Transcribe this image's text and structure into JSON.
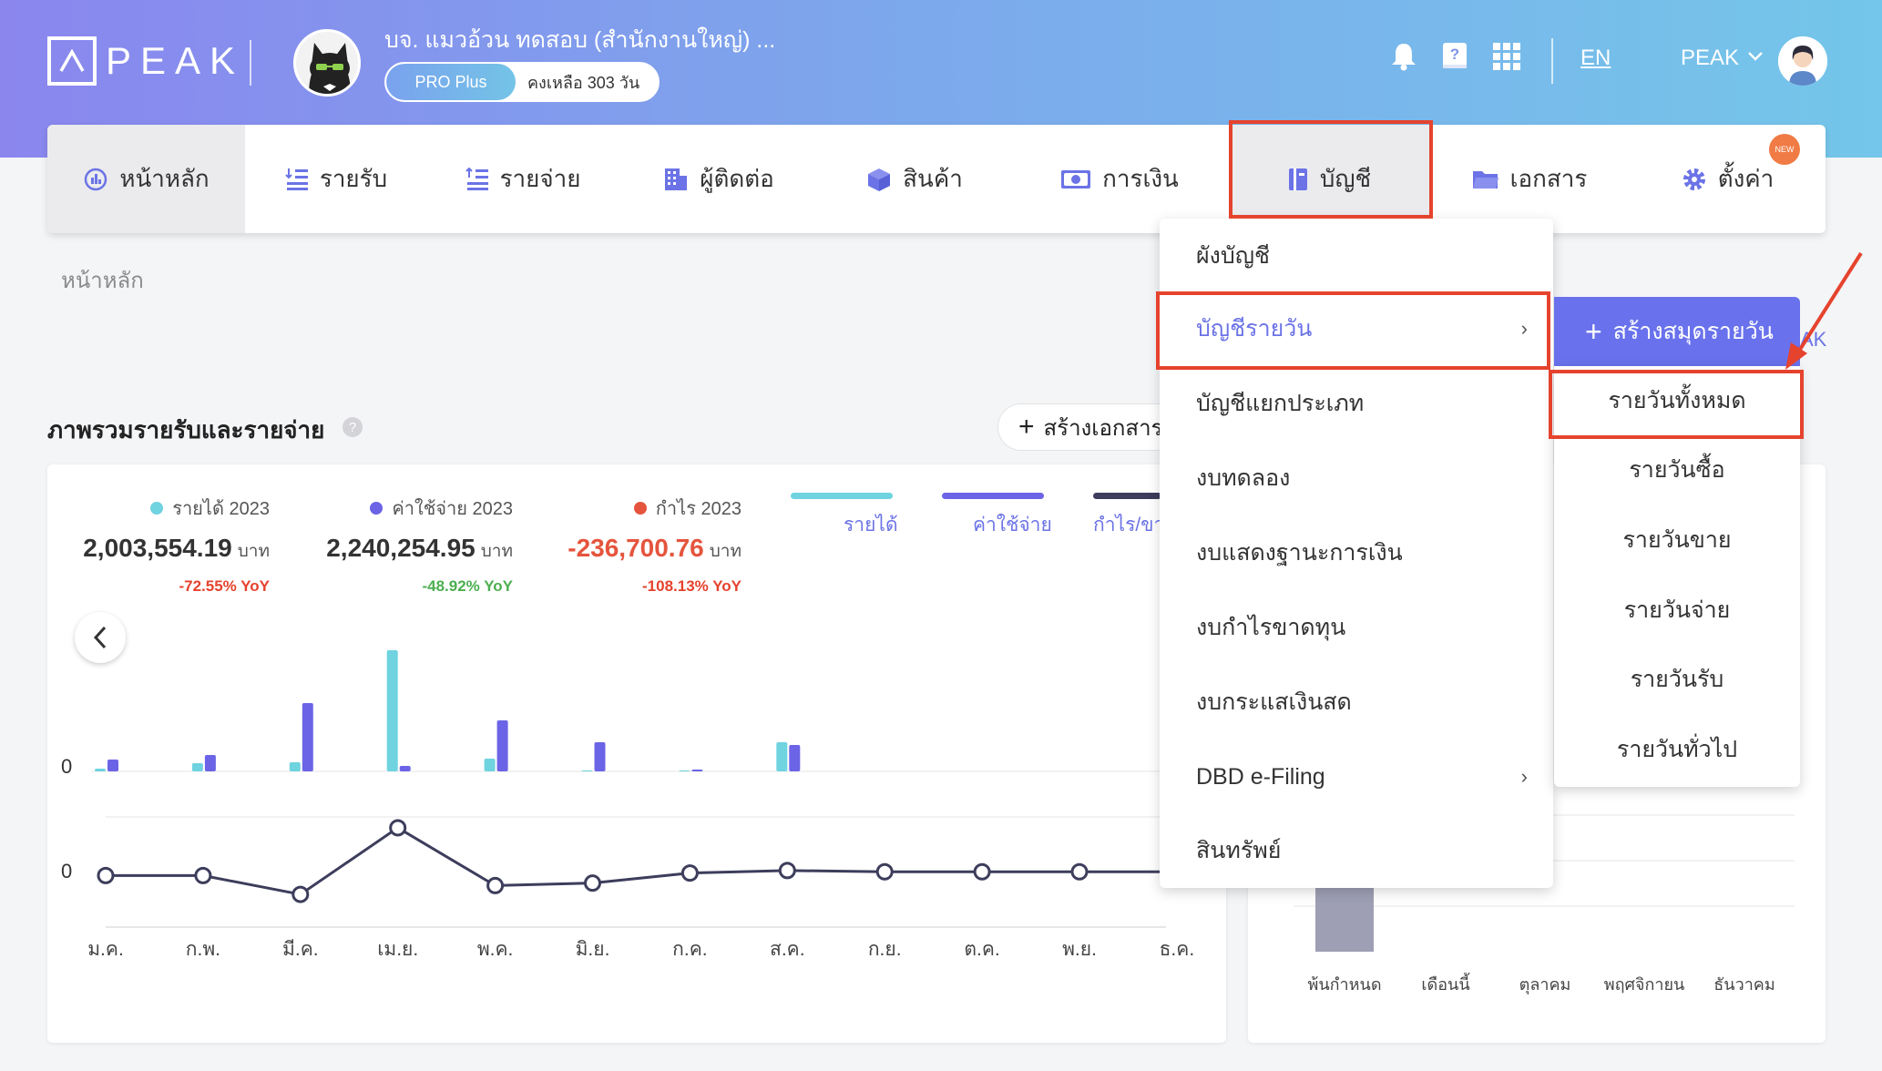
{
  "header": {
    "logo_text": "PEAK",
    "company_name": "บจ. แมวอ้วน ทดสอบ (สำนักงานใหญ่) ...",
    "plan": "PRO Plus",
    "plan_remaining": "คงเหลือ 303 วัน",
    "language": "EN",
    "user_name": "PEAK",
    "icons": [
      "bell-icon",
      "help-book-icon",
      "apps-grid-icon"
    ]
  },
  "nav": {
    "items": [
      {
        "label": "หน้าหลัก",
        "icon": "dashboard-icon"
      },
      {
        "label": "รายรับ",
        "icon": "income-list-icon"
      },
      {
        "label": "รายจ่าย",
        "icon": "expense-list-icon"
      },
      {
        "label": "ผู้ติดต่อ",
        "icon": "contacts-building-icon"
      },
      {
        "label": "สินค้า",
        "icon": "product-box-icon"
      },
      {
        "label": "การเงิน",
        "icon": "money-icon"
      },
      {
        "label": "บัญชี",
        "icon": "account-book-icon"
      },
      {
        "label": "เอกสาร",
        "icon": "folder-icon"
      },
      {
        "label": "ตั้งค่า",
        "icon": "gear-icon"
      }
    ],
    "new_badge": "NEW"
  },
  "breadcrumb": "หน้าหลัก",
  "overview": {
    "title": "ภาพรวมรายรับและรายจ่าย",
    "create_button": "สร้างเอกสาร",
    "kpis": [
      {
        "label": "รายได้ 2023",
        "value": "2,003,554.19",
        "unit": "บาท",
        "yoy": "-72.55% YoY",
        "color": "#6fd3e0",
        "yoy_color": "#e5432d"
      },
      {
        "label": "ค่าใช้จ่าย 2023",
        "value": "2,240,254.95",
        "unit": "บาท",
        "yoy": "-48.92% YoY",
        "color": "#6b64e6",
        "yoy_color": "#4caf50"
      },
      {
        "label": "กำไร 2023",
        "value": "-236,700.76",
        "unit": "บาท",
        "yoy": "-108.13% YoY",
        "color": "#e5543d",
        "yoy_color": "#e5432d"
      }
    ],
    "legend": [
      {
        "label": "รายได้",
        "color": "#6fd3e0"
      },
      {
        "label": "ค่าใช้จ่าย",
        "color": "#6b64e6"
      },
      {
        "label": "กำไร/ขา",
        "color": "#3d3d5c"
      }
    ],
    "zero_label": "0"
  },
  "chart_data": [
    {
      "type": "bar",
      "categories": [
        "ม.ค.",
        "ก.พ.",
        "มี.ค.",
        "เม.ย.",
        "พ.ค.",
        "มิ.ย.",
        "ก.ค.",
        "ส.ค.",
        "ก.ย.",
        "ต.ค.",
        "พ.ย.",
        "ธ.ค."
      ],
      "series": [
        {
          "name": "รายได้",
          "values": [
            3,
            9,
            10,
            133,
            14,
            1,
            1,
            32,
            0,
            0,
            0,
            0
          ]
        },
        {
          "name": "ค่าใช้จ่าย",
          "values": [
            13,
            18,
            75,
            6,
            56,
            32,
            2,
            29,
            0,
            0,
            0,
            0
          ]
        }
      ]
    },
    {
      "type": "line",
      "categories": [
        "ม.ค.",
        "ก.พ.",
        "มี.ค.",
        "เม.ย.",
        "พ.ค.",
        "มิ.ย.",
        "ก.ค.",
        "ส.ค.",
        "ก.ย.",
        "ต.ค.",
        "พ.ย.",
        "ธ.ค."
      ],
      "series": [
        {
          "name": "กำไร/ขา",
          "values": [
            -1,
            -1,
            -16,
            37,
            -9,
            -7,
            1,
            3,
            2,
            2,
            2,
            2
          ]
        }
      ]
    },
    {
      "type": "bar",
      "categories": [
        "พ้นกำหนด",
        "เดือนนี้",
        "ตุลาคม",
        "พฤศจิกายน",
        "ธันวาคม"
      ],
      "series": [
        {
          "values": [
            1,
            0,
            0,
            0,
            0
          ]
        }
      ]
    }
  ],
  "dropdown": {
    "items": [
      {
        "label": "ผังบัญชี",
        "has_sub": false
      },
      {
        "label": "บัญชีรายวัน",
        "has_sub": true
      },
      {
        "label": "บัญชีแยกประเภท",
        "has_sub": false
      },
      {
        "label": "งบทดลอง",
        "has_sub": false
      },
      {
        "label": "งบแสดงฐานะการเงิน",
        "has_sub": false
      },
      {
        "label": "งบกำไรขาดทุน",
        "has_sub": false
      },
      {
        "label": "งบกระแสเงินสด",
        "has_sub": false
      },
      {
        "label": "DBD e-Filing",
        "has_sub": true
      },
      {
        "label": "สินทรัพย์",
        "has_sub": false
      }
    ],
    "chevron": "›"
  },
  "submenu": {
    "create_button": "สร้างสมุดรายวัน",
    "under_text": "AK",
    "items": [
      "รายวันทั้งหมด",
      "รายวันซื้อ",
      "รายวันขาย",
      "รายวันจ่าย",
      "รายวันรับ",
      "รายวันทั่วไป"
    ]
  }
}
